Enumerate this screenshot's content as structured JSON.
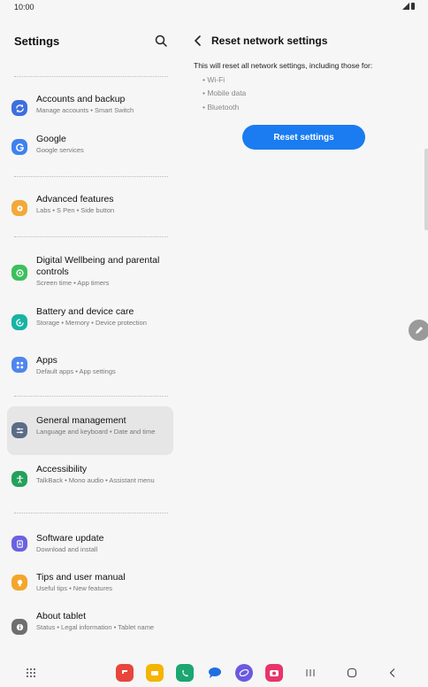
{
  "status_bar": {
    "time": "10:00"
  },
  "left_pane": {
    "title": "Settings",
    "items": [
      {
        "title": "Accounts and backup",
        "subtitle": "Manage accounts  •  Smart Switch",
        "color": "#3d6fe0"
      },
      {
        "title": "Google",
        "subtitle": "Google services",
        "color": "#3e82f0"
      },
      {
        "title": "Advanced features",
        "subtitle": "Labs  •  S Pen  •  Side button",
        "color": "#f2a93b"
      },
      {
        "title": "Digital Wellbeing and parental controls",
        "subtitle": "Screen time  •  App timers",
        "color": "#3cc05c"
      },
      {
        "title": "Battery and device care",
        "subtitle": "Storage  •  Memory  •  Device protection",
        "color": "#17b3a3"
      },
      {
        "title": "Apps",
        "subtitle": "Default apps  •  App settings",
        "color": "#4f86ee"
      },
      {
        "title": "General management",
        "subtitle": "Language and keyboard  •  Date and time",
        "color": "#5a6c86"
      },
      {
        "title": "Accessibility",
        "subtitle": "TalkBack  •  Mono audio  •  Assistant menu",
        "color": "#24a15a"
      },
      {
        "title": "Software update",
        "subtitle": "Download and install",
        "color": "#6a62e0"
      },
      {
        "title": "Tips and user manual",
        "subtitle": "Useful tips  •  New features",
        "color": "#f3a62b"
      },
      {
        "title": "About tablet",
        "subtitle": "Status  •  Legal information  •  Tablet name",
        "color": "#6f6f6f"
      }
    ]
  },
  "right_pane": {
    "title": "Reset network settings",
    "description": "This will reset all network settings, including those for:",
    "bullets": [
      "Wi-Fi",
      "Mobile data",
      "Bluetooth"
    ],
    "reset_button": "Reset settings",
    "accent": "#1a7cf0"
  },
  "nav_bar": {
    "apps": [
      {
        "name": "flipboard-icon",
        "color": "#e8453c"
      },
      {
        "name": "folder-icon",
        "color": "#f5b400"
      },
      {
        "name": "phone-icon",
        "color": "#1ba672"
      },
      {
        "name": "messages-icon",
        "color": "#1e6fe0"
      },
      {
        "name": "internet-icon",
        "color": "#6a5ae0"
      },
      {
        "name": "camera-icon",
        "color": "#e8346a"
      }
    ]
  }
}
